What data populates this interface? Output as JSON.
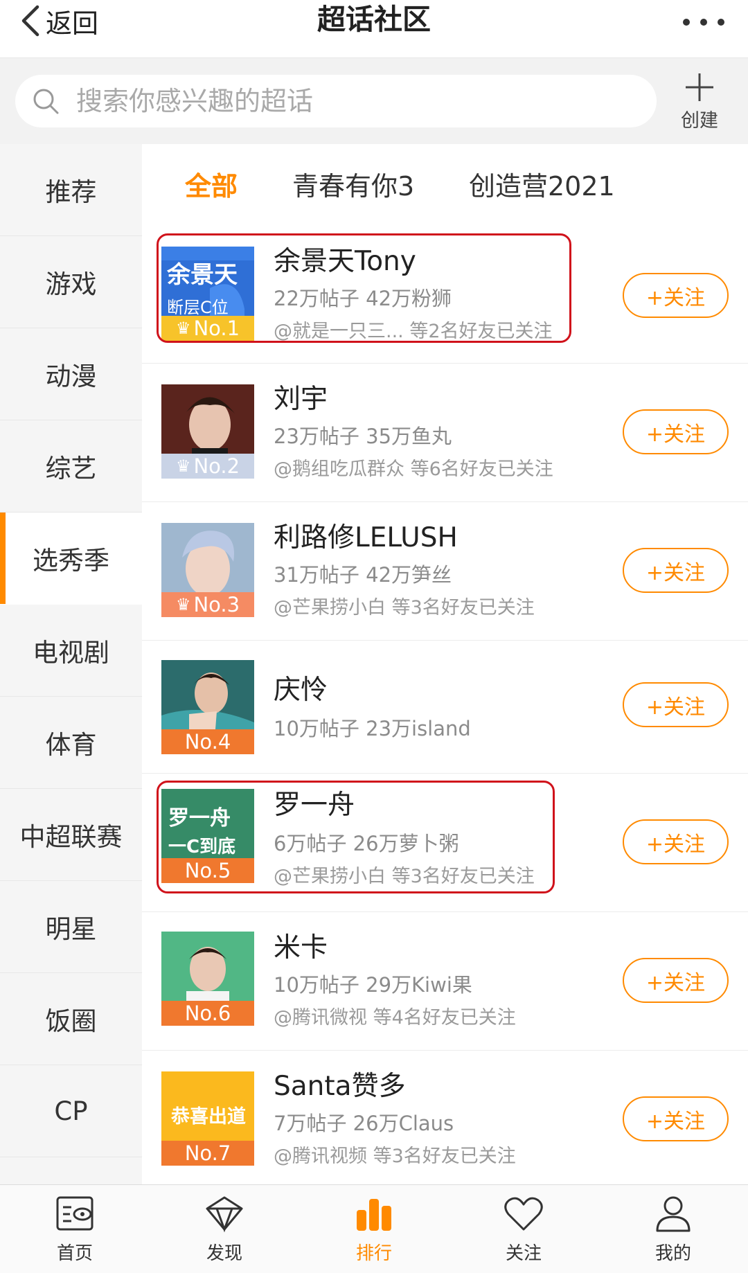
{
  "nav": {
    "back_label": "返回",
    "title": "超话社区"
  },
  "search": {
    "placeholder": "搜索你感兴趣的超话",
    "create_label": "创建"
  },
  "sidebar": {
    "items": [
      {
        "label": "推荐"
      },
      {
        "label": "游戏"
      },
      {
        "label": "动漫"
      },
      {
        "label": "综艺"
      },
      {
        "label": "选秀季",
        "active": true
      },
      {
        "label": "电视剧"
      },
      {
        "label": "体育"
      },
      {
        "label": "中超联赛"
      },
      {
        "label": "明星"
      },
      {
        "label": "饭圈"
      },
      {
        "label": "CP"
      }
    ]
  },
  "tabs": [
    {
      "label": "全部",
      "active": true
    },
    {
      "label": "青春有你3"
    },
    {
      "label": "创造营2021"
    }
  ],
  "follow_label": "+关注",
  "list": [
    {
      "rank": "No.1",
      "name": "余景天Tony",
      "stats": "22万帖子 42万粉狮",
      "friends": "@就是一只三... 等2名好友已关注",
      "thumb_text": "余景天",
      "thumb_text2": "断层C位"
    },
    {
      "rank": "No.2",
      "name": "刘宇",
      "stats": "23万帖子 35万鱼丸",
      "friends": "@鹅组吃瓜群众 等6名好友已关注"
    },
    {
      "rank": "No.3",
      "name": "利路修LELUSH",
      "stats": "31万帖子 42万笋丝",
      "friends": "@芒果捞小白 等3名好友已关注"
    },
    {
      "rank": "No.4",
      "name": "庆怜",
      "stats": "10万帖子 23万island",
      "friends": ""
    },
    {
      "rank": "No.5",
      "name": "罗一舟",
      "stats": "6万帖子 26万萝卜粥",
      "friends": "@芒果捞小白 等3名好友已关注",
      "thumb_text": "罗一舟",
      "thumb_text2": "一C到底"
    },
    {
      "rank": "No.6",
      "name": "米卡",
      "stats": "10万帖子 29万Kiwi果",
      "friends": "@腾讯微视 等4名好友已关注"
    },
    {
      "rank": "No.7",
      "name": "Santa赞多",
      "stats": "7万帖子 26万Claus",
      "friends": "@腾讯视频 等3名好友已关注",
      "thumb_text": "恭喜出道"
    }
  ],
  "tabbar": [
    {
      "label": "首页",
      "icon": "home-icon"
    },
    {
      "label": "发现",
      "icon": "discover-icon"
    },
    {
      "label": "排行",
      "icon": "ranking-icon",
      "active": true
    },
    {
      "label": "关注",
      "icon": "heart-icon"
    },
    {
      "label": "我的",
      "icon": "profile-icon"
    }
  ],
  "colors": {
    "accent": "#ff8a00",
    "highlight_box": "#d0121b"
  }
}
